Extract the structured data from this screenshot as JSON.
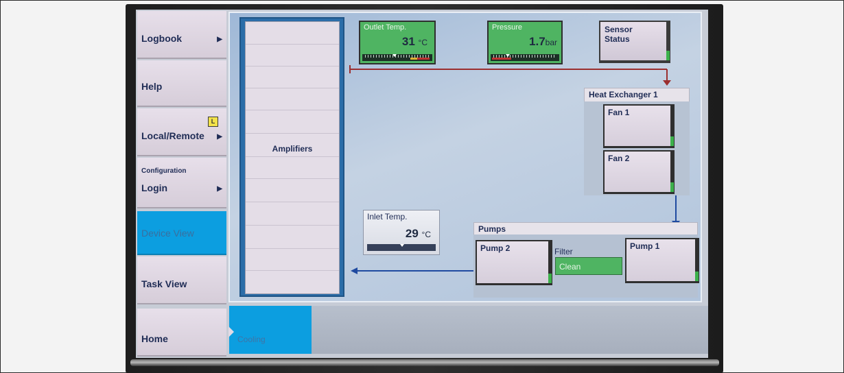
{
  "sidebar": {
    "items": [
      {
        "label": "Logbook",
        "has_arrow": true
      },
      {
        "label": "Help"
      },
      {
        "label": "Local/Remote",
        "has_arrow": true,
        "badge": "L"
      },
      {
        "label": "Login",
        "caption": "Configuration",
        "has_arrow": true
      },
      {
        "label": "Device View",
        "active": true
      },
      {
        "label": "Task View"
      },
      {
        "label": "Home"
      }
    ],
    "arrow_glyph": "▶"
  },
  "breadcrumb": {
    "current_tab": "Cooling"
  },
  "amplifiers": {
    "label": "Amplifiers"
  },
  "gauges": {
    "outlet": {
      "title": "Outlet Temp.",
      "value": "31",
      "unit": "°C"
    },
    "pressure": {
      "title": "Pressure",
      "value": "1.7",
      "unit": "bar"
    },
    "inlet": {
      "title": "Inlet Temp.",
      "value": "29",
      "unit": "°C"
    }
  },
  "sensor_status": {
    "line1": "Sensor",
    "line2": "Status"
  },
  "heat_exchanger": {
    "title": "Heat Exchanger 1",
    "fans": [
      {
        "label": "Fan 1"
      },
      {
        "label": "Fan 2"
      }
    ]
  },
  "pumps": {
    "title": "Pumps",
    "pump_left": "Pump 2",
    "pump_right": "Pump 1",
    "filter_label": "Filter",
    "filter_status": "Clean"
  },
  "colors": {
    "active_blue": "#0c9ee0",
    "ok_green": "#4fb462",
    "flow_return": "#9b2e2e",
    "flow_supply": "#1f4aa0"
  }
}
